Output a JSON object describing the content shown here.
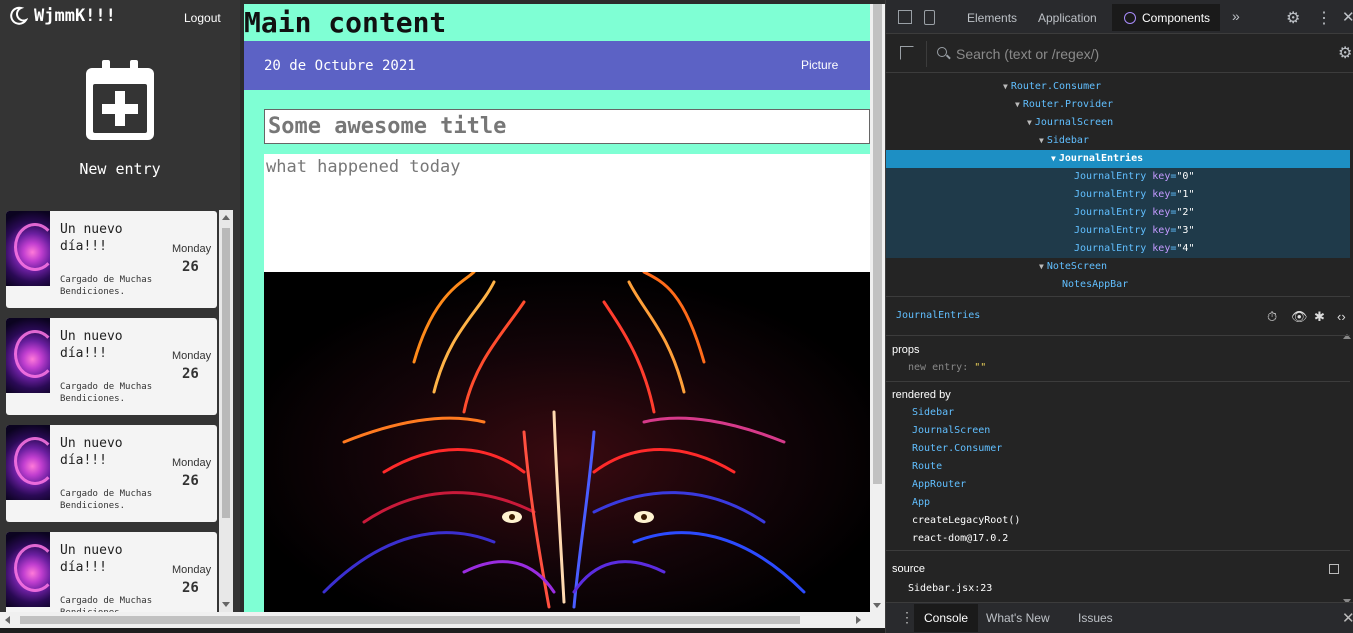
{
  "sidebar": {
    "user_name": "WjmmK!!!",
    "logout_label": "Logout",
    "new_entry_label": "New entry",
    "entries": [
      {
        "title": "Un nuevo día!!!",
        "body": "Cargado de Muchas Bendiciones.",
        "weekday": "Monday",
        "day": "26"
      },
      {
        "title": "Un nuevo día!!!",
        "body": "Cargado de Muchas Bendiciones.",
        "weekday": "Monday",
        "day": "26"
      },
      {
        "title": "Un nuevo día!!!",
        "body": "Cargado de Muchas Bendiciones.",
        "weekday": "Monday",
        "day": "26"
      },
      {
        "title": "Un nuevo día!!!",
        "body": "Cargado de Muchas Bendiciones.",
        "weekday": "Monday",
        "day": "26"
      }
    ]
  },
  "main": {
    "heading": "Main content",
    "appbar": {
      "date": "20 de Octubre 2021",
      "picture_label": "Picture"
    },
    "title_placeholder": "Some awesome title",
    "body_placeholder": "what happened today"
  },
  "devtools": {
    "tabs": [
      "Elements",
      "Application",
      "Components"
    ],
    "active_tab": "Components",
    "more_tabs_icon": "»",
    "search_placeholder": "Search (text or /regex/)",
    "tree": [
      {
        "label": "Router.Consumer",
        "depth": 0
      },
      {
        "label": "Router.Provider",
        "depth": 1
      },
      {
        "label": "JournalScreen",
        "depth": 2
      },
      {
        "label": "Sidebar",
        "depth": 3
      },
      {
        "label": "JournalEntries",
        "depth": 4,
        "selected": true
      },
      {
        "label": "JournalEntry",
        "key": "0",
        "depth": 5
      },
      {
        "label": "JournalEntry",
        "key": "1",
        "depth": 5
      },
      {
        "label": "JournalEntry",
        "key": "2",
        "depth": 5
      },
      {
        "label": "JournalEntry",
        "key": "3",
        "depth": 5
      },
      {
        "label": "JournalEntry",
        "key": "4",
        "depth": 5
      },
      {
        "label": "NoteScreen",
        "depth": 3
      },
      {
        "label": "NotesAppBar",
        "depth": 4
      }
    ],
    "selected_component": "JournalEntries",
    "props_title": "props",
    "props": [
      {
        "name": "new entry",
        "value": "\"\""
      }
    ],
    "rendered_by_title": "rendered by",
    "rendered_by": [
      "Sidebar",
      "JournalScreen",
      "Router.Consumer",
      "Route",
      "AppRouter",
      "App",
      "createLegacyRoot()",
      "react-dom@17.0.2"
    ],
    "source_title": "source",
    "source_file": "Sidebar.jsx:23",
    "drawer_tabs": [
      "Console",
      "What's New",
      "Issues"
    ],
    "drawer_active": "Console"
  },
  "colors": {
    "main_bg": "#7fffd4",
    "appbar_bg": "#5c62c5",
    "sidebar_bg": "#343434",
    "selected_row": "#1d8fc4"
  }
}
